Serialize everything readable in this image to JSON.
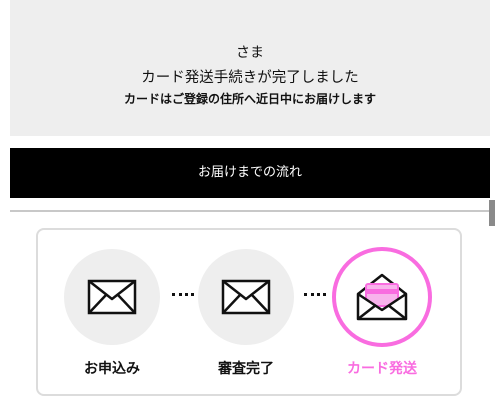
{
  "hero": {
    "name_suffix": "さま",
    "title": "カード発送手続きが完了しました",
    "subtitle": "カードはご登録の住所へ近日中にお届けします"
  },
  "flow": {
    "heading": "お届けまでの流れ"
  },
  "steps": [
    {
      "label": "お申込み",
      "icon": "envelope-icon",
      "state": "complete"
    },
    {
      "label": "審査完了",
      "icon": "envelope-icon",
      "state": "complete"
    },
    {
      "label": "カード発送",
      "icon": "envelope-open-card-icon",
      "state": "current"
    }
  ],
  "colors": {
    "accent": "#f96ce0",
    "step_bg": "#eeeeee",
    "hero_bg": "#eeeeee",
    "bar_bg": "#000000"
  }
}
